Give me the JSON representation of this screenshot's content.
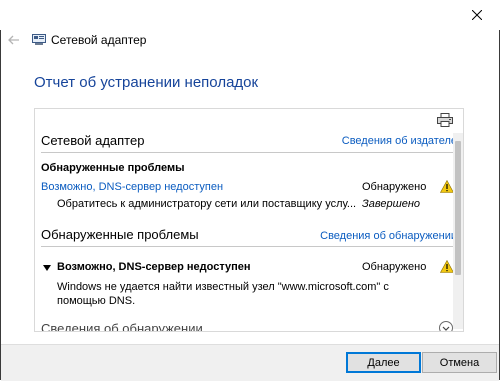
{
  "window": {
    "title": "Сетевой адаптер",
    "heading": "Отчет об устранении неполадок"
  },
  "section1": {
    "title": "Сетевой адаптер",
    "publisher_link": "Сведения об издателе",
    "problems_label": "Обнаруженные проблемы",
    "problem_link": "Возможно, DNS-сервер недоступен",
    "problem_status": "Обнаружено",
    "action_text": "Обратитесь к администратору сети или поставщику услу...",
    "action_status": "Завершено"
  },
  "section2": {
    "title": "Обнаруженные проблемы",
    "details_link": "Сведения об обнаружении",
    "problem_title": "Возможно, DNS-сервер недоступен",
    "problem_status": "Обнаружено",
    "description_line1": "Windows не удается найти известный узел \"www.microsoft.com\" с",
    "description_line2": "помощью DNS."
  },
  "section3": {
    "title_partial": "Сведения об обнаружении"
  },
  "buttons": {
    "next": "Далее",
    "cancel": "Отмена"
  },
  "colors": {
    "heading": "#16449a",
    "link": "#0b5cc0",
    "warning": "#f2c811",
    "primary_border": "#0078d7"
  },
  "icons": {
    "close": "close-icon",
    "back": "back-arrow-icon",
    "app": "network-adapter-icon",
    "print": "printer-icon",
    "warning": "warning-icon",
    "expand_triangle": "triangle-down-icon",
    "chevron": "chevron-down-circle-icon"
  }
}
